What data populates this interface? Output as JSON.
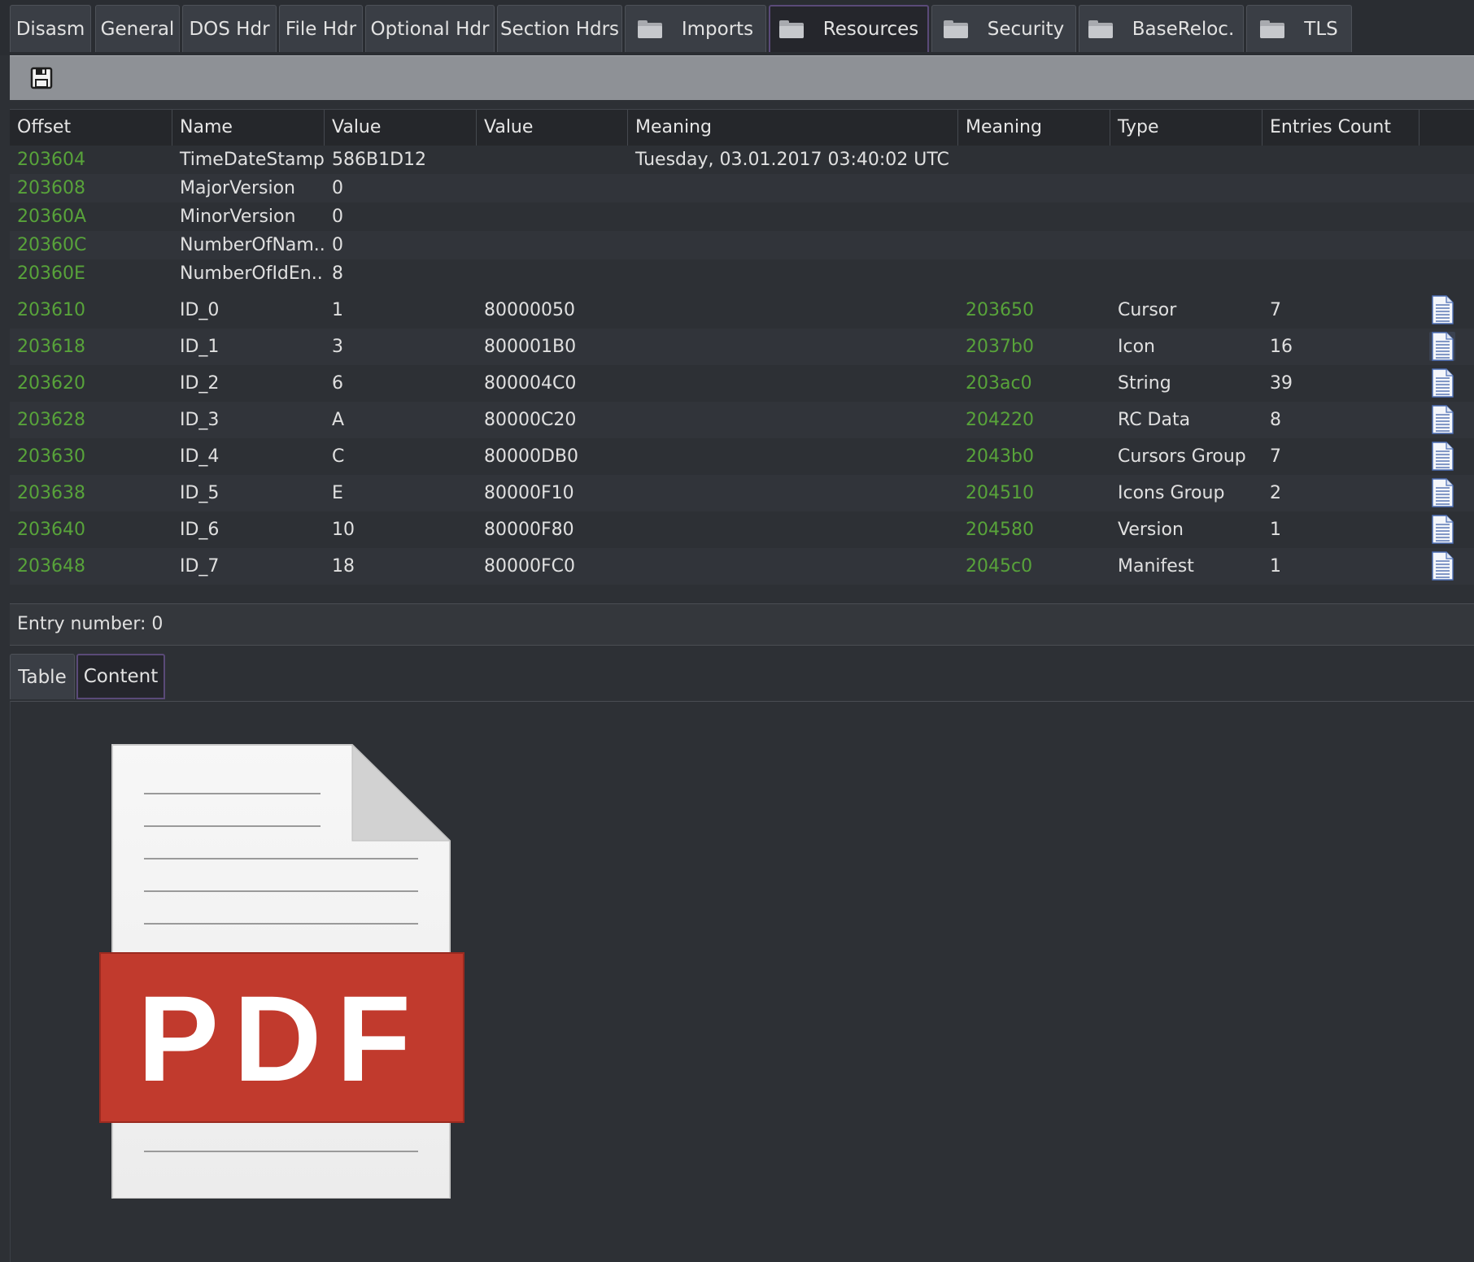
{
  "tabs": [
    {
      "label": "Disasm",
      "folder": false,
      "active": false
    },
    {
      "label": "General",
      "folder": false,
      "active": false
    },
    {
      "label": "DOS Hdr",
      "folder": false,
      "active": false
    },
    {
      "label": "File Hdr",
      "folder": false,
      "active": false
    },
    {
      "label": "Optional Hdr",
      "folder": false,
      "active": false
    },
    {
      "label": "Section Hdrs",
      "folder": false,
      "active": false
    },
    {
      "label": "Imports",
      "folder": true,
      "active": false
    },
    {
      "label": "Resources",
      "folder": true,
      "active": true
    },
    {
      "label": "Security",
      "folder": true,
      "active": false
    },
    {
      "label": "BaseReloc.",
      "folder": true,
      "active": false
    },
    {
      "label": "TLS",
      "folder": true,
      "active": false
    }
  ],
  "toolbar": {
    "save_icon": "save-icon"
  },
  "table": {
    "columns": [
      "Offset",
      "Name",
      "Value",
      "Value",
      "Meaning",
      "Meaning",
      "Type",
      "Entries Count"
    ],
    "header_rows": [
      {
        "offset": "203604",
        "name": "TimeDateStamp",
        "value": "586B1D12",
        "meaning": "Tuesday, 03.01.2017 03:40:02 UTC"
      },
      {
        "offset": "203608",
        "name": "MajorVersion",
        "value": "0",
        "meaning": ""
      },
      {
        "offset": "20360A",
        "name": "MinorVersion",
        "value": "0",
        "meaning": ""
      },
      {
        "offset": "20360C",
        "name": "NumberOfNam...",
        "value": "0",
        "meaning": ""
      },
      {
        "offset": "20360E",
        "name": "NumberOfIdEn...",
        "value": "8",
        "meaning": ""
      }
    ],
    "entry_rows": [
      {
        "offset": "203610",
        "name": "ID_0",
        "value1": "1",
        "value2": "80000050",
        "meaning2": "203650",
        "type": "Cursor",
        "count": "7"
      },
      {
        "offset": "203618",
        "name": "ID_1",
        "value1": "3",
        "value2": "800001B0",
        "meaning2": "2037b0",
        "type": "Icon",
        "count": "16"
      },
      {
        "offset": "203620",
        "name": "ID_2",
        "value1": "6",
        "value2": "800004C0",
        "meaning2": "203ac0",
        "type": "String",
        "count": "39"
      },
      {
        "offset": "203628",
        "name": "ID_3",
        "value1": "A",
        "value2": "80000C20",
        "meaning2": "204220",
        "type": "RC Data",
        "count": "8"
      },
      {
        "offset": "203630",
        "name": "ID_4",
        "value1": "C",
        "value2": "80000DB0",
        "meaning2": "2043b0",
        "type": "Cursors Group",
        "count": "7"
      },
      {
        "offset": "203638",
        "name": "ID_5",
        "value1": "E",
        "value2": "80000F10",
        "meaning2": "204510",
        "type": "Icons Group",
        "count": "2"
      },
      {
        "offset": "203640",
        "name": "ID_6",
        "value1": "10",
        "value2": "80000F80",
        "meaning2": "204580",
        "type": "Version",
        "count": "1"
      },
      {
        "offset": "203648",
        "name": "ID_7",
        "value1": "18",
        "value2": "80000FC0",
        "meaning2": "2045c0",
        "type": "Manifest",
        "count": "1"
      }
    ],
    "row_icon": "document-icon"
  },
  "entry_number": "Entry number: 0",
  "bottom_tabs": [
    {
      "label": "Table",
      "active": false
    },
    {
      "label": "Content",
      "active": true
    }
  ],
  "content": {
    "icon": "pdf-file-icon",
    "badge_text": "PDF"
  },
  "colors": {
    "offset_green": "#58a33a",
    "pdf_red": "#c13a2d",
    "active_tab_border": "#5a4a78"
  }
}
